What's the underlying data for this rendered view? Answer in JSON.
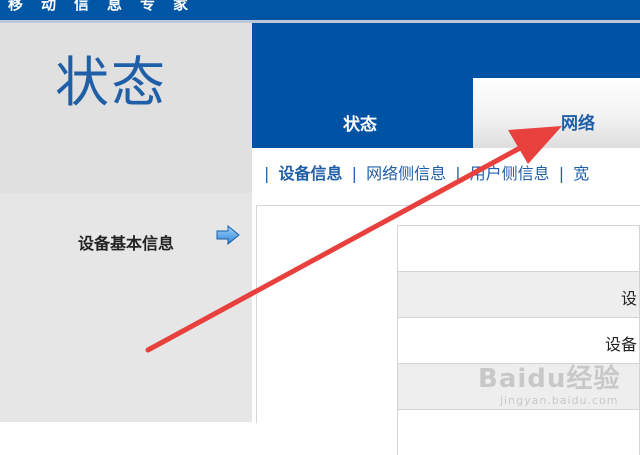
{
  "top_bar": {
    "text": "移动信息专家"
  },
  "header": {
    "title": "状态"
  },
  "tabs": [
    {
      "label": "状态",
      "active": false
    },
    {
      "label": "网络",
      "active": true
    }
  ],
  "subnav": {
    "items": [
      {
        "label": "设备信息",
        "active": true
      },
      {
        "label": "网络侧信息",
        "active": false
      },
      {
        "label": "用户侧信息",
        "active": false
      },
      {
        "label": "宽",
        "active": false
      }
    ]
  },
  "sidebar": {
    "section_label": "设备基本信息",
    "arrow_icon": "arrow-right-icon"
  },
  "table": {
    "rows": [
      {
        "text": "",
        "shaded": false
      },
      {
        "text": "设",
        "shaded": true
      },
      {
        "text": "设备",
        "shaded": false
      },
      {
        "text": "",
        "shaded": true
      },
      {
        "text": "",
        "shaded": false
      }
    ]
  },
  "annotation": {
    "color": "#e8403c"
  },
  "watermark": {
    "main": "Baidu经验",
    "sub": "jingyan.baidu.com"
  },
  "colors": {
    "brand_blue": "#0052a4",
    "text_blue": "#1f5fa8",
    "panel_gray": "#e0e0e0"
  }
}
